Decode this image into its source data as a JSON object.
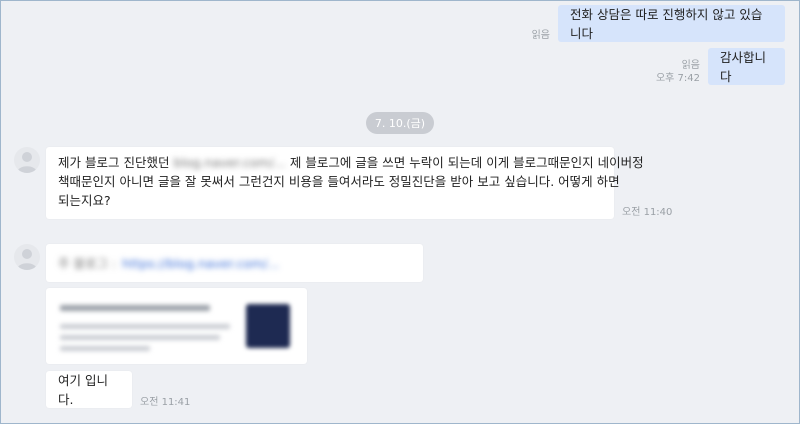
{
  "messages_out": [
    {
      "text": "전화 상담은 따로 진행하지 않고 있습니다",
      "read": "읽음",
      "time": ""
    },
    {
      "text": "감사합니다",
      "read": "읽음",
      "time": "오후 7:42"
    }
  ],
  "date_divider": "7. 10.(금)",
  "message_in_1": {
    "line1_a": "제가 블로그 진단했던",
    "line1_redacted": "blog.naver.com/...",
    "line1_b": "제 블로그에 글을 쓰면 누락이 되는데 이게 블로그때문인지 네이버정",
    "line2": "책때문인지 아니면 글을 잘 못써서 그런건지 비용을 들여서라도 정밀진단을 받아 보고 싶습니다. 어떻게 하면",
    "line3": "되는지요?",
    "time": "오전 11:40"
  },
  "message_in_2": {
    "link_prefix": "주 블로그 :",
    "link_url": "https://blog.naver.com/...",
    "preview_title": "",
    "preview_desc": "",
    "text": "여기 입니다.",
    "time": "오전 11:41"
  }
}
